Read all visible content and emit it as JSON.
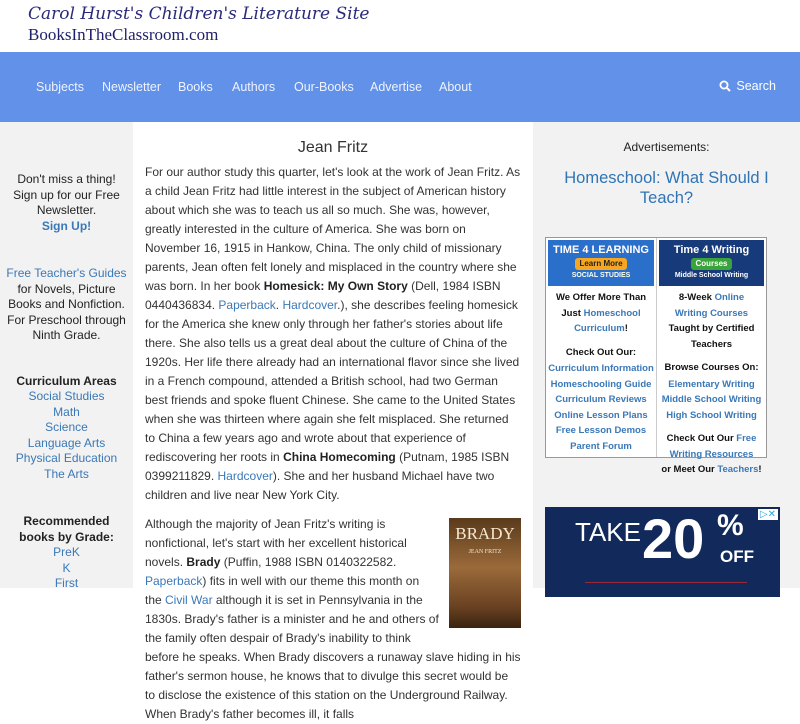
{
  "header": {
    "site_title": "Carol Hurst's Children's Literature Site",
    "site_domain": "BooksInTheClassroom.com"
  },
  "nav": {
    "items": [
      "Subjects",
      "Newsletter",
      "Books",
      "Authors",
      "Our-Books",
      "Advertise",
      "About"
    ],
    "search": "Search"
  },
  "left": {
    "newsletter": "Don't miss a thing! Sign up for our Free Newsletter.",
    "signup": "Sign Up!",
    "guides_link": "Free Teacher's Guides",
    "guides_text": "for Novels, Picture Books and Nonfiction. For Preschool through Ninth Grade.",
    "curriculum_heading": "Curriculum Areas",
    "curriculum": [
      "Social Studies",
      "Math",
      "Science",
      "Language Arts",
      "Physical Education",
      "The Arts"
    ],
    "grade_heading": "Recommended books by Grade:",
    "grades": [
      "PreK",
      "K",
      "First"
    ]
  },
  "main": {
    "title": "Jean Fritz",
    "book_cover": {
      "title": "BRADY",
      "author": "JEAN FRITZ"
    },
    "paragraphs": [
      [
        {
          "t": "For our author study this quarter, let's look at the work of Jean Fritz. As a child Jean Fritz had little interest in the subject of American history about which she was to teach us all so much. She was, however, greatly interested in the culture of America. She was born on November 16, 1915 in Hankow, China. The only child of missionary parents, Jean often felt lonely and misplaced in the country where she was born. In her book "
        },
        {
          "b": "Homesick: My Own Story"
        },
        {
          "t": " (Dell, 1984 ISBN 0440436834. "
        },
        {
          "a": "Paperback"
        },
        {
          "t": ". "
        },
        {
          "a": "Hardcover"
        },
        {
          "t": ".), she describes feeling homesick for the America she knew only through her father's stories about life there. She also tells us a great deal about the culture of China of the 1920s. Her life there already had an international flavor since she lived in a French compound, attended a British school, had two German best friends and spoke fluent Chinese. She came to the United States when she was thirteen where again she felt misplaced. She returned to China a few years ago and wrote about that experience of rediscovering her roots in "
        },
        {
          "b": "China Homecoming"
        },
        {
          "t": " (Putnam, 1985 ISBN 0399211829. "
        },
        {
          "a": "Hardcover"
        },
        {
          "t": "). She and her husband Michael have two children and live near New York City."
        }
      ],
      [
        {
          "t": "Although the majority of Jean Fritz's writing is nonfictional, let's start with her excellent historical novels. "
        },
        {
          "b": "Brady"
        },
        {
          "t": " (Puffin, 1988 ISBN 0140322582. "
        },
        {
          "a": "Paperback"
        },
        {
          "t": ") fits in well with our theme this month on the "
        },
        {
          "a": "Civil War"
        },
        {
          "t": " although it is set in Pennsylvania in the 1830s. Brady's father is a minister and he and others of the family often despair of Brady's inability to think before he speaks. When Brady discovers a runaway slave hiding in his father's sermon house, he knows that to divulge this secret would be to disclose the existence of this station on the Underground Railway. When Brady's father becomes ill, it falls"
        }
      ]
    ]
  },
  "right": {
    "ads_label": "Advertisements:",
    "ad_headline": "Homeschool: What Should I Teach?",
    "ad_left": {
      "banner": "TIME 4 LEARNING",
      "banner_btn": "Learn More",
      "banner_tag": "SOCIAL STUDIES",
      "intro1": "We Offer More Than Just ",
      "intro_link": "Homeschool Curriculum",
      "intro2": "!",
      "heading": "Check Out Our:",
      "links": [
        "Curriculum Information",
        "Homeschooling Guide",
        "Curriculum Reviews",
        "Online Lesson Plans",
        "Free Lesson Demos",
        "Parent Forum"
      ]
    },
    "ad_right": {
      "banner": "Time 4 Writing",
      "banner_btn": "Courses",
      "banner_tag": "Middle School Writing",
      "intro1": "8-Week ",
      "intro_link": "Online Writing Courses",
      "intro2": " Taught by Certified Teachers",
      "heading": "Browse Courses On:",
      "links": [
        "Elementary Writing",
        "Middle School Writing",
        "High School Writing"
      ],
      "more1": "Check Out Our ",
      "more_link": "Free Writing Resources",
      "more2": "or Meet Our ",
      "more_link2": "Teachers",
      "more3": "!"
    },
    "ad2": {
      "take": "TAKE",
      "amount": "20",
      "pct": "%",
      "off": "OFF"
    }
  }
}
